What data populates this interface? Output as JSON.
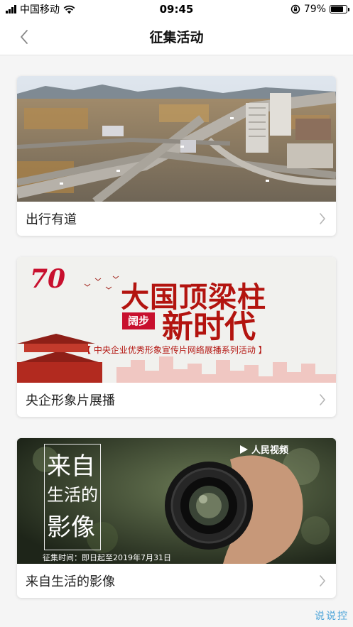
{
  "status_bar": {
    "carrier": "中国移动",
    "time": "09:45",
    "battery": "79%",
    "battery_level": 0.79,
    "icons": [
      "signal-icon",
      "wifi-icon",
      "orientation-lock-icon",
      "battery-icon"
    ]
  },
  "nav": {
    "title": "征集活动",
    "back_icon": "chevron-left-icon"
  },
  "cards": [
    {
      "label": "出行有道",
      "image": "city-overpass-photo"
    },
    {
      "label": "央企形象片展播",
      "image": "poster-banner",
      "banner": {
        "anniversary": "70",
        "headline": "大国顶梁柱",
        "tag": "阔步",
        "subheadline": "新时代",
        "caption": "【 中央企业优秀形象宣传片网络展播系列活动 】"
      }
    },
    {
      "label": "来自生活的影像",
      "image": "camera-lens-photo",
      "banner": {
        "title_line1": "来自",
        "title_line2": "生活的",
        "title_line3": "影像",
        "deadline": "征集时间：即日起至2019年7月31日",
        "logo": "人民视频"
      }
    }
  ],
  "watermark": "说说控",
  "colors": {
    "accent_red": "#c8102e",
    "watermark_blue": "#4aa3d8"
  }
}
